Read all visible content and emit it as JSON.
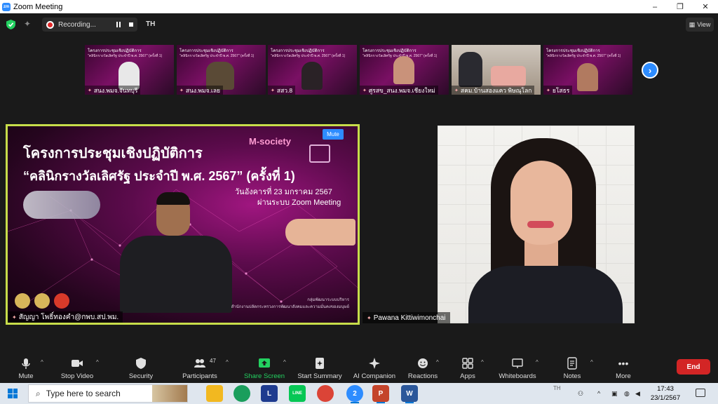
{
  "window": {
    "title": "Zoom Meeting",
    "controls": [
      "–",
      "❐",
      "✕"
    ]
  },
  "topbar": {
    "recording_label": "Recording...",
    "language": "TH",
    "view_label": "View"
  },
  "thumbnails": [
    {
      "name": "สนง.พมจ.จันทบุรี",
      "slide_title": "โครงการประชุมเชิงปฏิบัติการ"
    },
    {
      "name": "สนง.พมจ.เลย",
      "slide_title": "โครงการประชุมเชิงปฏิบัติการ"
    },
    {
      "name": "สสว.8",
      "slide_title": "โครงการประชุมเชิงปฏิบัติการ"
    },
    {
      "name": "ศูรสข_สนง.พมจ.เชียงใหม่",
      "slide_title": "โครงการประชุมเชิงปฏิบัติการ"
    },
    {
      "name": "สคม.บ้านสองแคว พิษณุโลก",
      "slide_title": ""
    },
    {
      "name": "ยโสธร",
      "slide_title": "โครงการประชุมเชิงปฏิบัติการ"
    }
  ],
  "thumb_subtitle": "\"คลินิกรางวัลเลิศรัฐ ประจำปี พ.ศ. 2567\" (ครั้งที่ 1)",
  "main_left": {
    "mute_label": "Mute",
    "brand": "M-society",
    "slide_title": "โครงการประชุมเชิงปฏิบัติการ",
    "slide_subtitle": "“คลินิกรางวัลเลิศรัฐ ประจำปี พ.ศ. 2567” (ครั้งที่ 1)",
    "date_line": "วันอังคารที่ 23 มกราคม 2567",
    "via_line": "ผ่านระบบ Zoom Meeting",
    "footnote_1": "กลุ่มพัฒนาระบบบริหาร",
    "footnote_2": "สำนักงานปลัดกระทรวงการพัฒนาสังคมและความมั่นคงของมนุษย์",
    "participant_name": "สัญญา โพธิ์ทองคำ@กพบ.สป.พม."
  },
  "main_right": {
    "participant_name": "Pawana Kittiwimonchai"
  },
  "toolbar": {
    "mute": "Mute",
    "stop_video": "Stop Video",
    "security": "Security",
    "participants": "Participants",
    "participants_count": "47",
    "share_screen": "Share Screen",
    "start_summary": "Start Summary",
    "ai_companion": "AI Companion",
    "reactions": "Reactions",
    "apps": "Apps",
    "whiteboards": "Whiteboards",
    "notes": "Notes",
    "more": "More",
    "end": "End"
  },
  "taskbar": {
    "search_placeholder": "Type here to search",
    "lang": "TH",
    "time": "17:43",
    "date": "23/1/2567",
    "apps": [
      {
        "name": "file-explorer",
        "color": "#f2b820",
        "label": ""
      },
      {
        "name": "edge",
        "color": "#1a9e5c",
        "label": ""
      },
      {
        "name": "l-app",
        "color": "#1e3b8f",
        "label": "L"
      },
      {
        "name": "line",
        "color": "#06c755",
        "label": "LINE"
      },
      {
        "name": "chrome",
        "color": "#db4437",
        "label": ""
      },
      {
        "name": "zoom",
        "color": "#2d8cff",
        "label": "2"
      },
      {
        "name": "powerpoint",
        "color": "#c4442b",
        "label": "P"
      },
      {
        "name": "word",
        "color": "#2b579a",
        "label": "W"
      }
    ]
  },
  "colors": {
    "active_speaker_border": "#c7dd4a",
    "end_button": "#d32525",
    "share_green": "#23d160",
    "zoom_blue": "#2d8cff"
  }
}
